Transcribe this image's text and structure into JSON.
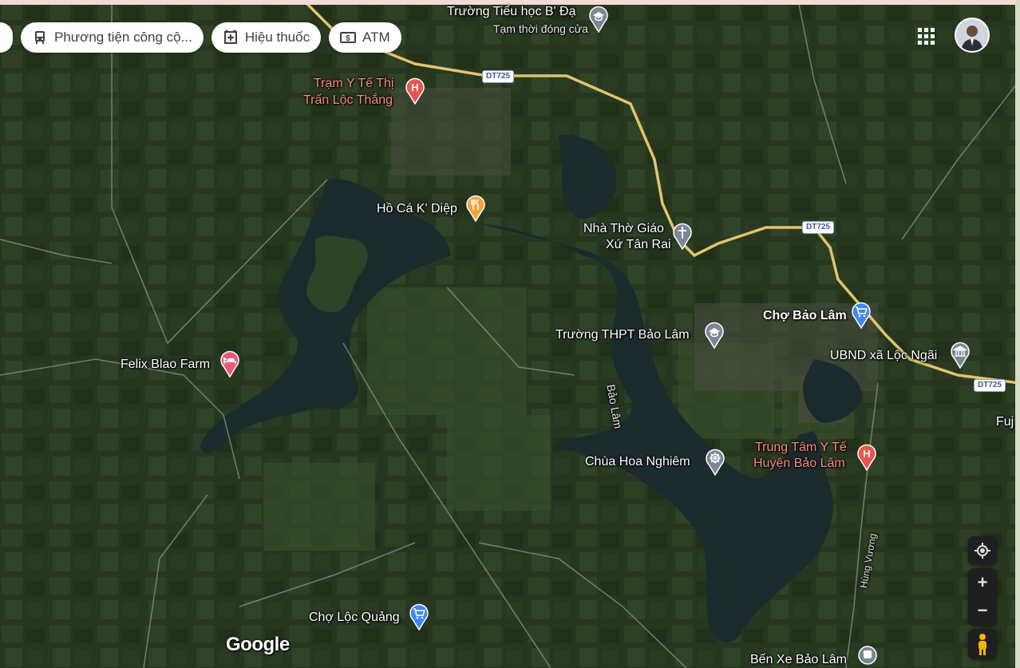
{
  "filters": [
    {
      "label": "Phương tiện công cộ...",
      "icon": "transit-icon"
    },
    {
      "label": "Hiệu thuốc",
      "icon": "pharmacy-icon"
    },
    {
      "label": "ATM",
      "icon": "atm-icon"
    }
  ],
  "places": {
    "school_bda": {
      "name": "Trường Tiểu học B' Đạ",
      "status": "Tạm thời đóng cửa"
    },
    "tram_yte": {
      "line1": "Trạm Y Tế Thị",
      "line2": "Trấn Lộc Thắng"
    },
    "ho_ca": "Hồ Cá K' Diệp",
    "nha_tho": {
      "line1": "Nhà Thờ Giáo",
      "line2": "Xứ Tân Rai"
    },
    "cho_bao_lam": "Chợ Bảo Lâm",
    "thpt": "Trường THPT Bảo Lâm",
    "ubnd": "UBND xã Lộc Ngãi",
    "felix": "Felix Blao Farm",
    "lake": "Bảo Lâm",
    "chua": "Chùa Hoa Nghiêm",
    "trung_tam": {
      "line1": "Trung Tâm Y Tế",
      "line2": "Huyện Bảo Lâm"
    },
    "fuj": "Fuj",
    "hung_vuong": "Hùng Vương",
    "cho_loc_quang": "Chợ Lộc Quảng",
    "ben_xe": "Bến Xe Bảo Lâm"
  },
  "roads": {
    "dt725": "DT725"
  },
  "logo": "Google",
  "controls": {
    "zoom_in": "+",
    "zoom_out": "−"
  },
  "colors": {
    "satellite_dark": "#24331f",
    "lake": "#1b2a2b",
    "road": "#e2c36a",
    "hospital_pin": "#e8554e",
    "place_pin": "#7b8794",
    "shopping_pin": "#4285f4",
    "food_pin": "#f2a33a",
    "hotel_pin": "#e8597a"
  }
}
